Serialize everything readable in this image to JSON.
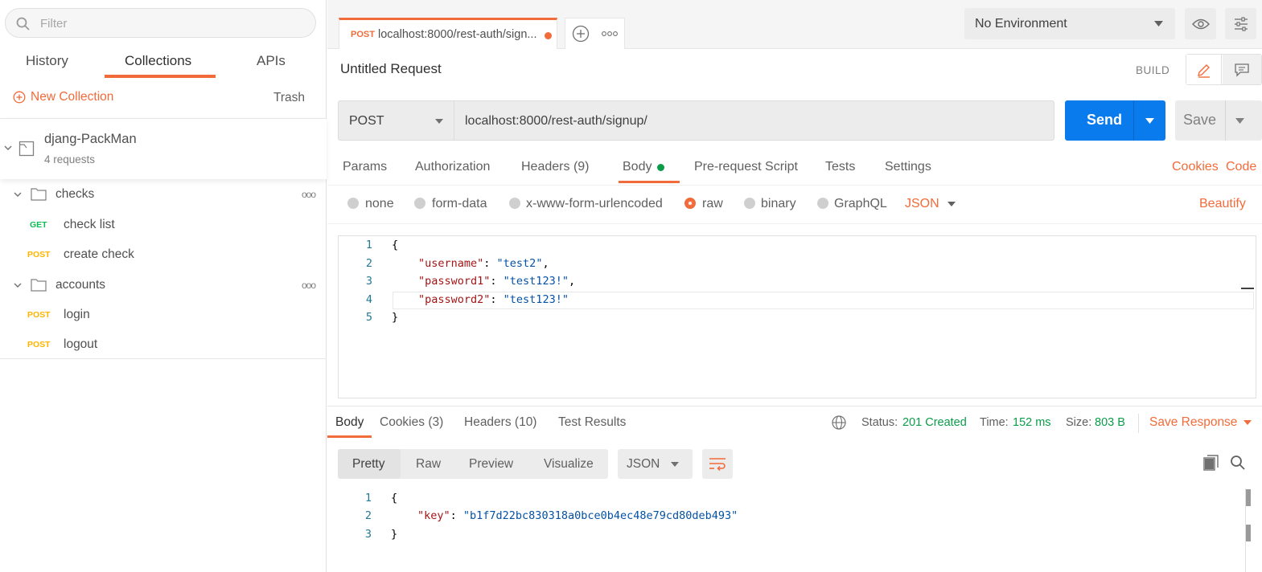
{
  "sidebar": {
    "filter_placeholder": "Filter",
    "tabs": [
      "History",
      "Collections",
      "APIs"
    ],
    "new_collection": "New Collection",
    "trash": "Trash",
    "collection": {
      "name": "djang-PackMan",
      "count": "4 requests"
    },
    "folders": [
      {
        "name": "checks",
        "requests": [
          {
            "method": "GET",
            "name": "check list"
          },
          {
            "method": "POST",
            "name": "create check"
          }
        ]
      },
      {
        "name": "accounts",
        "requests": [
          {
            "method": "POST",
            "name": "login"
          },
          {
            "method": "POST",
            "name": "logout"
          }
        ]
      }
    ],
    "more_icon": "ooo"
  },
  "tab": {
    "method": "POST",
    "title": "localhost:8000/rest-auth/sign..."
  },
  "environment": {
    "selected": "No Environment"
  },
  "request": {
    "name": "Untitled Request",
    "build": "BUILD",
    "method": "POST",
    "url": "localhost:8000/rest-auth/signup/",
    "send": "Send",
    "save": "Save",
    "tabs": {
      "params": "Params",
      "authorization": "Authorization",
      "headers": "Headers",
      "headers_count": "(9)",
      "body": "Body",
      "prerequest": "Pre-request Script",
      "tests": "Tests",
      "settings": "Settings"
    },
    "cookies": "Cookies",
    "code": "Code",
    "body_types": [
      "none",
      "form-data",
      "x-www-form-urlencoded",
      "raw",
      "binary",
      "GraphQL"
    ],
    "format": "JSON",
    "beautify": "Beautify",
    "body_lines": [
      {
        "n": "1",
        "text": "{"
      },
      {
        "n": "2",
        "key": "\"username\"",
        "val": "\"test2\"",
        "end": ","
      },
      {
        "n": "3",
        "key": "\"password1\"",
        "val": "\"test123!\"",
        "end": ","
      },
      {
        "n": "4",
        "key": "\"password2\"",
        "val": "\"test123!\"",
        "end": ""
      },
      {
        "n": "5",
        "text": "}"
      }
    ]
  },
  "response": {
    "tabs": {
      "body": "Body",
      "cookies": "Cookies",
      "cookies_count": "(3)",
      "headers": "Headers",
      "headers_count": "(10)",
      "tests": "Test Results"
    },
    "status_label": "Status:",
    "status": "201 Created",
    "time_label": "Time:",
    "time": "152 ms",
    "size_label": "Size:",
    "size": "803 B",
    "save_response": "Save Response",
    "views": [
      "Pretty",
      "Raw",
      "Preview",
      "Visualize"
    ],
    "format": "JSON",
    "lines": [
      {
        "n": "1",
        "text": "{"
      },
      {
        "n": "2",
        "key": "\"key\"",
        "val": "\"b1f7d22bc830318a0bce0b4ec48e79cd80deb493\""
      },
      {
        "n": "3",
        "text": "}"
      }
    ]
  },
  "colors": {
    "accent": "#f26b3a",
    "send": "#097bed",
    "get": "#0cbb52",
    "post": "#ffb400",
    "status_ok": "#0b9c4a"
  }
}
